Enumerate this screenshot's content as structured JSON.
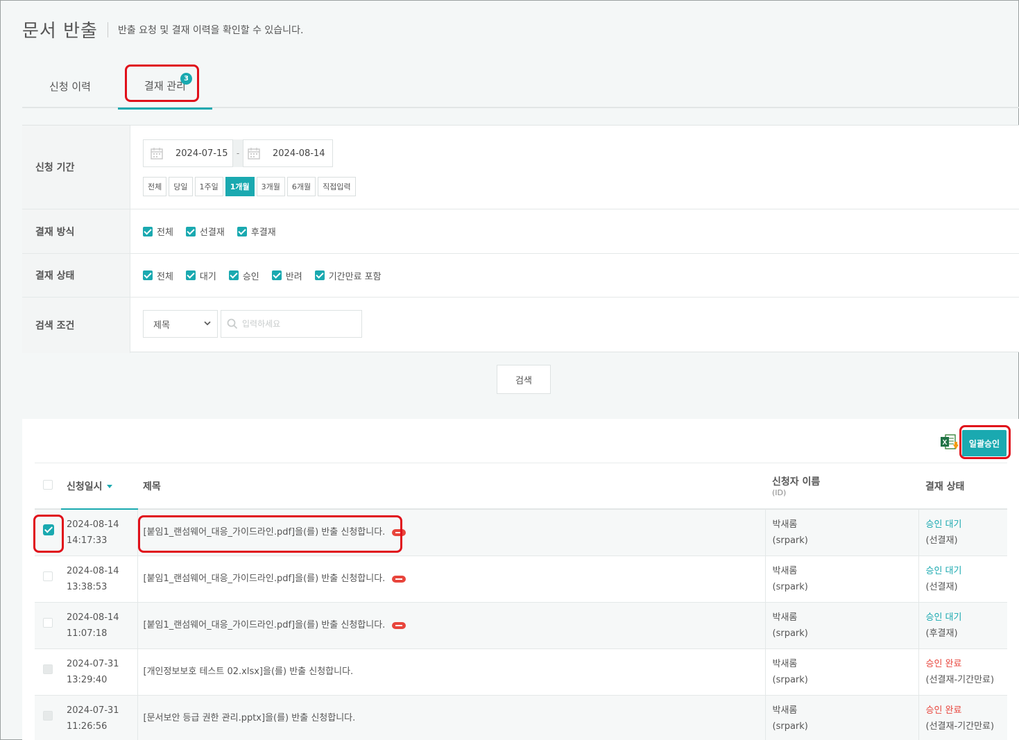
{
  "header": {
    "title": "문서 반출",
    "subtitle": "반출 요청 및 결재 이력을 확인할 수 있습니다."
  },
  "tabs": [
    {
      "label": "신청 이력",
      "active": false
    },
    {
      "label": "결재 관리",
      "active": true,
      "badge": "3"
    }
  ],
  "filters": {
    "period": {
      "label": "신청 기간",
      "start_date": "2024-07-15",
      "end_date": "2024-08-14",
      "separator": "-",
      "buttons": [
        "전체",
        "당일",
        "1주일",
        "1개월",
        "3개월",
        "6개월",
        "직접입력"
      ],
      "active_button": "1개월"
    },
    "method": {
      "label": "결재 방식",
      "options": [
        "전체",
        "선결재",
        "후결재"
      ]
    },
    "status": {
      "label": "결재 상태",
      "options": [
        "전체",
        "대기",
        "승인",
        "반려",
        "기간만료 포함"
      ]
    },
    "condition": {
      "label": "검색 조건",
      "select_value": "제목",
      "placeholder": "입력하세요"
    },
    "search_label": "검색"
  },
  "results": {
    "bulk_approve_label": "일괄승인",
    "excel_icon": "excel-download-icon",
    "columns": {
      "date": "신청일시",
      "title": "제목",
      "user": "신청자 이름",
      "user_sub": "(ID)",
      "status": "결재 상태"
    },
    "rows": [
      {
        "date": "2024-08-14",
        "time": "14:17:33",
        "title": "[붙임1_랜섬웨어_대응_가이드라인.pdf]을(를) 반출 신청합니다.",
        "new": true,
        "name": "박새롬",
        "id": "(srpark)",
        "status": "승인 대기",
        "status_type": "wait",
        "method": "(선결재)",
        "checked": true,
        "disabled": false
      },
      {
        "date": "2024-08-14",
        "time": "13:38:53",
        "title": "[붙임1_랜섬웨어_대응_가이드라인.pdf]을(를) 반출 신청합니다.",
        "new": true,
        "name": "박새롬",
        "id": "(srpark)",
        "status": "승인 대기",
        "status_type": "wait",
        "method": "(선결재)",
        "checked": false,
        "disabled": false
      },
      {
        "date": "2024-08-14",
        "time": "11:07:18",
        "title": "[붙임1_랜섬웨어_대응_가이드라인.pdf]을(를) 반출 신청합니다.",
        "new": true,
        "name": "박새롬",
        "id": "(srpark)",
        "status": "승인 대기",
        "status_type": "wait",
        "method": "(후결재)",
        "checked": false,
        "disabled": false
      },
      {
        "date": "2024-07-31",
        "time": "13:29:40",
        "title": "[개인정보보호 테스트 02.xlsx]을(를) 반출 신청합니다.",
        "new": false,
        "name": "박새롬",
        "id": "(srpark)",
        "status": "승인 완료",
        "status_type": "done",
        "method": "(선결재-기간만료)",
        "checked": false,
        "disabled": true
      },
      {
        "date": "2024-07-31",
        "time": "11:26:56",
        "title": "[문서보안 등급 권한 관리.pptx]을(를) 반출 신청합니다.",
        "new": false,
        "name": "박새롬",
        "id": "(srpark)",
        "status": "승인 완료",
        "status_type": "done",
        "method": "(선결재-기간만료)",
        "checked": false,
        "disabled": true
      }
    ]
  },
  "colors": {
    "accent": "#1aa9b0",
    "highlight": "#e0101a",
    "status_done": "#e8453c"
  }
}
